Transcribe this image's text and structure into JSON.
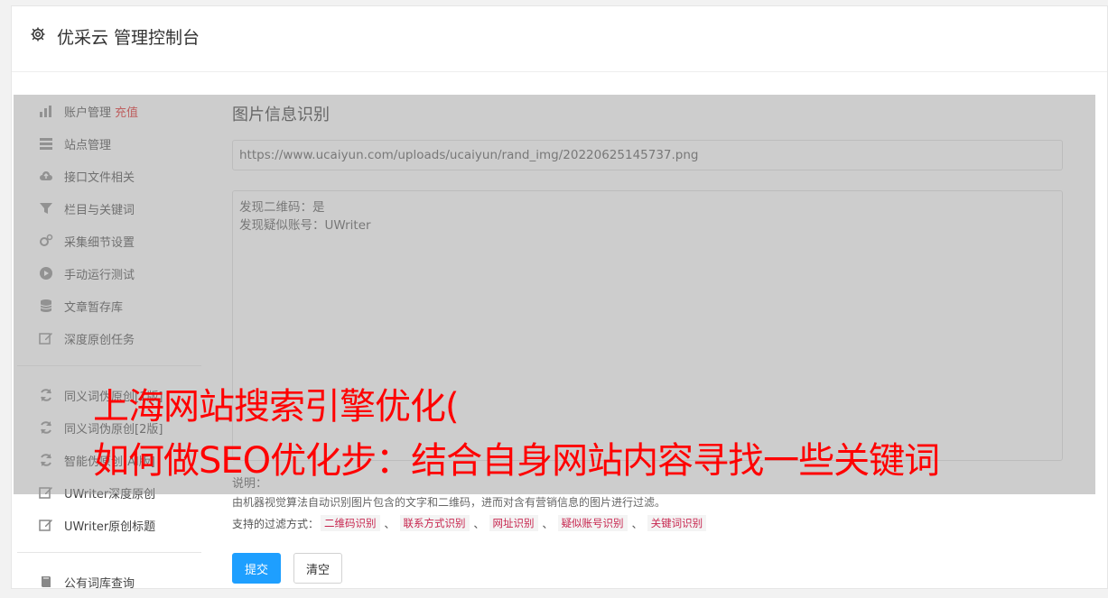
{
  "header": {
    "title": "优采云 管理控制台"
  },
  "sidebar": {
    "group1": [
      {
        "label": "账户管理",
        "extra": "充值",
        "icon": "bar-chart-icon"
      },
      {
        "label": "站点管理",
        "icon": "server-icon"
      },
      {
        "label": "接口文件相关",
        "icon": "cloud-upload-icon"
      },
      {
        "label": "栏目与关键词",
        "icon": "filter-icon"
      },
      {
        "label": "采集细节设置",
        "icon": "cogs-icon"
      },
      {
        "label": "手动运行测试",
        "icon": "play-circle-icon"
      },
      {
        "label": "文章暂存库",
        "icon": "database-icon"
      },
      {
        "label": "深度原创任务",
        "icon": "edit-icon"
      }
    ],
    "group2": [
      {
        "label": "同义词伪原创[1版]",
        "icon": "refresh-icon"
      },
      {
        "label": "同义词伪原创[2版]",
        "icon": "refresh-icon"
      },
      {
        "label": "智能伪原创[AI版]",
        "icon": "refresh-icon"
      },
      {
        "label": "UWriter深度原创",
        "icon": "edit-icon"
      },
      {
        "label": "UWriter原创标题",
        "icon": "edit-icon"
      }
    ],
    "group3": [
      {
        "label": "公有词库查询",
        "icon": "book-icon"
      }
    ]
  },
  "main": {
    "section_title": "图片信息识别",
    "url_value": "https://www.ucaiyun.com/uploads/ucaiyun/rand_img/20220625145737.png",
    "result_lines": [
      "发现二维码：是",
      "发现疑似账号：UWriter"
    ],
    "explain_label": "说明：",
    "explain_text": "由机器视觉算法自动识别图片包含的文字和二维码，进而对含有营销信息的图片进行过滤。",
    "filters_label": "支持的过滤方式：",
    "filters": [
      "二维码识别",
      "联系方式识别",
      "网址识别",
      "疑似账号识别",
      "关键词识别"
    ],
    "filter_sep": "、",
    "submit_label": "提交",
    "clear_label": "清空"
  },
  "overlay_caption": {
    "line1": "上海网站搜索引擎优化(",
    "line2": "如何做SEO优化步：结合自身网站内容寻找一些关键词"
  },
  "colors": {
    "primary": "#1e9fff",
    "recharge": "#e02424",
    "caption": "#ff0000",
    "tag_text": "#c7254e"
  }
}
